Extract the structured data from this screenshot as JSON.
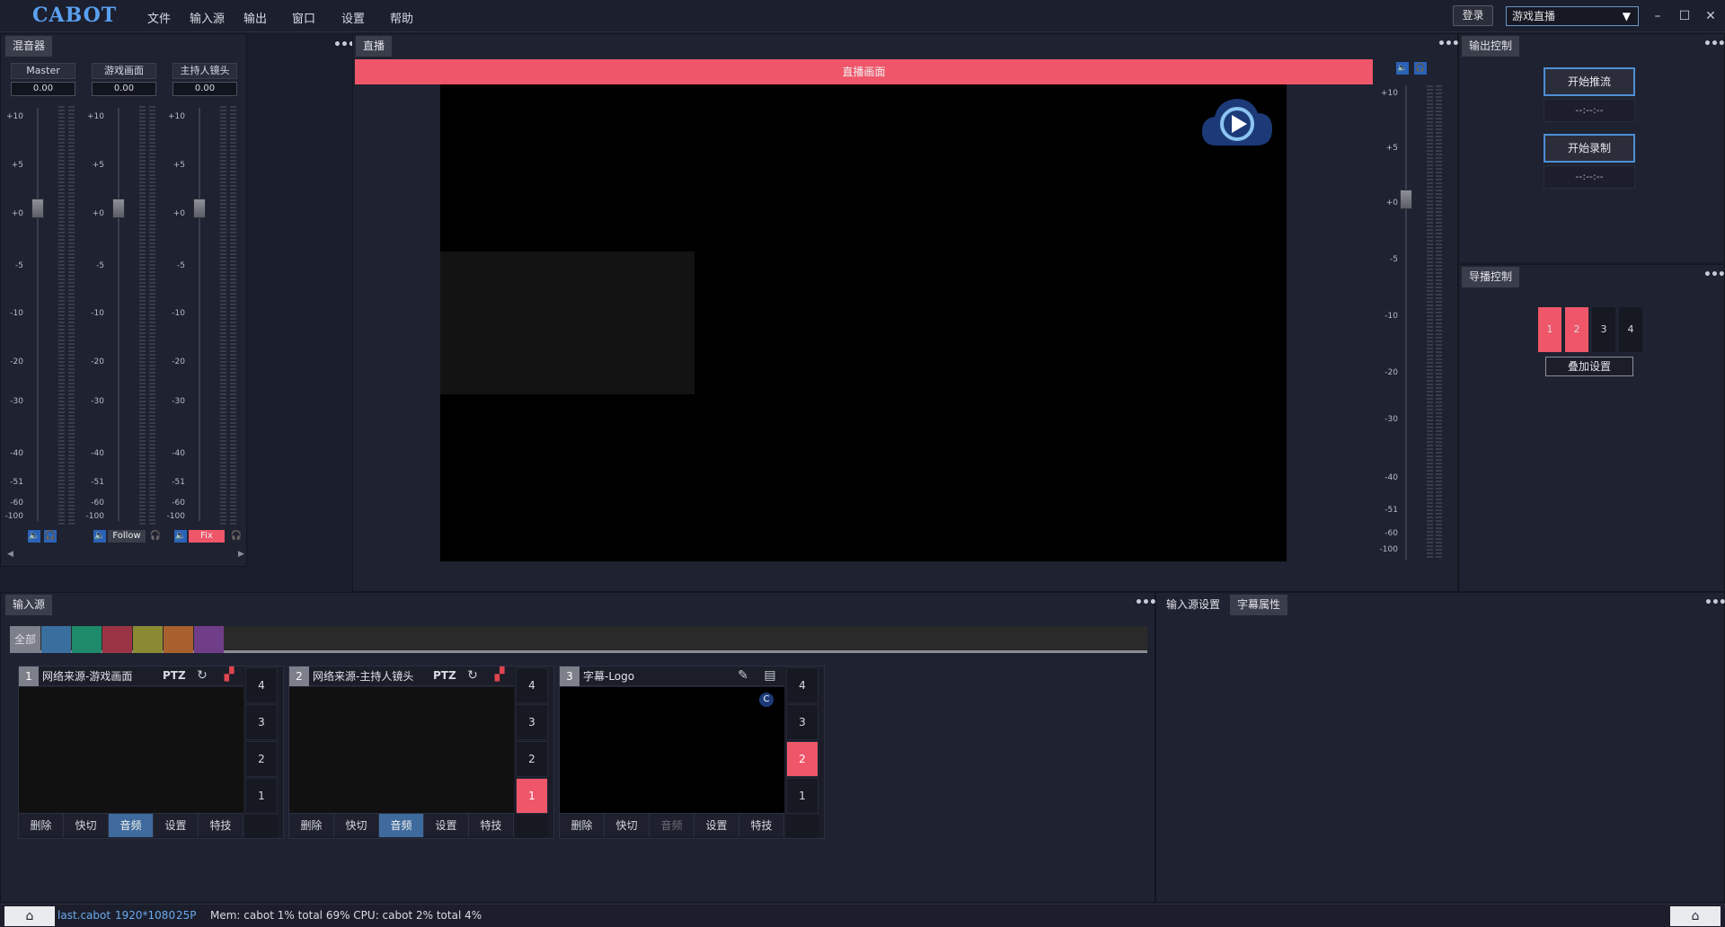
{
  "app": {
    "logo": "CABOT"
  },
  "menu": [
    "文件",
    "输入源",
    "输出",
    "窗口",
    "设置",
    "帮助"
  ],
  "header": {
    "login_label": "登录",
    "scene_select": "游戏直播"
  },
  "mixer": {
    "tab_label": "混音器",
    "scale": [
      "+10",
      "+5",
      "+0",
      "-5",
      "-10",
      "-20",
      "-30",
      "-40",
      "-51",
      "-60",
      "-100"
    ],
    "channels": [
      {
        "name": "Master",
        "value": "0.00",
        "mode": ""
      },
      {
        "name": "游戏画面",
        "value": "0.00",
        "mode": "Follow"
      },
      {
        "name": "主持人镜头",
        "value": "0.00",
        "mode": "Fix"
      }
    ]
  },
  "live": {
    "tab_label": "直播",
    "bar_label": "直播画面",
    "volume_scale": [
      "+10",
      "+5",
      "+0",
      "-5",
      "-10",
      "-20",
      "-30",
      "-40",
      "-51",
      "-60",
      "-100"
    ]
  },
  "output": {
    "tab_label": "输出控制",
    "stream_label": "开始推流",
    "stream_time": "--:--:--",
    "record_label": "开始录制",
    "record_time": "--:--:--"
  },
  "director": {
    "tab_label": "导播控制",
    "boxes": [
      "1",
      "2",
      "3",
      "4"
    ],
    "active": [
      true,
      true,
      false,
      false
    ],
    "overlay_label": "叠加设置"
  },
  "input": {
    "tab_label": "输入源",
    "filter_all": "全部",
    "colors": [
      "#3a6e9e",
      "#1e8a6a",
      "#9a3444",
      "#8a8a33",
      "#a8602e",
      "#703d88"
    ],
    "sources": [
      {
        "num": "1",
        "title": "网络来源-游戏画面",
        "ptz": "PTZ",
        "buttons": [
          "删除",
          "快切",
          "音频",
          "设置",
          "特技"
        ],
        "active_btn": 2,
        "pgm": [
          "4",
          "3",
          "2",
          "1"
        ],
        "pgm_on": "1_off"
      },
      {
        "num": "2",
        "title": "网络来源-主持人镜头",
        "ptz": "PTZ",
        "buttons": [
          "删除",
          "快切",
          "音频",
          "设置",
          "特技"
        ],
        "active_btn": 2,
        "pgm": [
          "4",
          "3",
          "2",
          "1"
        ],
        "pgm_on": "1"
      },
      {
        "num": "3",
        "title": "字幕-Logo",
        "buttons": [
          "删除",
          "快切",
          "音频",
          "设置",
          "特技"
        ],
        "active_btn": -1,
        "pgm": [
          "4",
          "3",
          "2",
          "1"
        ],
        "pgm_on": "2"
      }
    ]
  },
  "props": {
    "tabs": [
      "输入源设置",
      "字幕属性"
    ],
    "active_tab": 1
  },
  "status": {
    "file": "last.cabot",
    "resolution": "1920*1080",
    "fps": "25P",
    "stats": "Mem: cabot 1% total 69% CPU: cabot 2% total 4%"
  }
}
